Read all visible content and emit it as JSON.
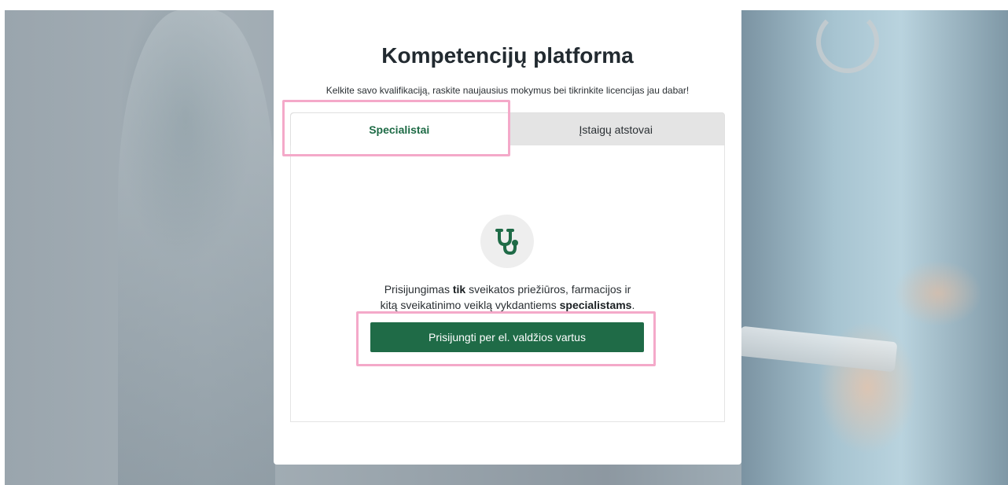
{
  "page": {
    "title": "Kompetencijų platforma",
    "subtitle": "Kelkite savo kvalifikaciją, raskite naujausius mokymus bei tikrinkite licencijas jau dabar!"
  },
  "tabs": [
    {
      "label": "Specialistai",
      "active": true
    },
    {
      "label": "Įstaigų atstovai",
      "active": false
    }
  ],
  "panel": {
    "icon": "stethoscope-icon",
    "description": {
      "part1": "Prisijungimas ",
      "bold1": "tik",
      "part2": " sveikatos priežiūros, farmacijos ir",
      "part3": "kitą sveikatinimo veiklą vykdantiems ",
      "bold2": "specialistams",
      "part4": "."
    },
    "login_button": "Prisijungti per el. valdžios vartus"
  },
  "colors": {
    "accent_green": "#1f6b47",
    "highlight_pink": "#f4a9c9"
  }
}
